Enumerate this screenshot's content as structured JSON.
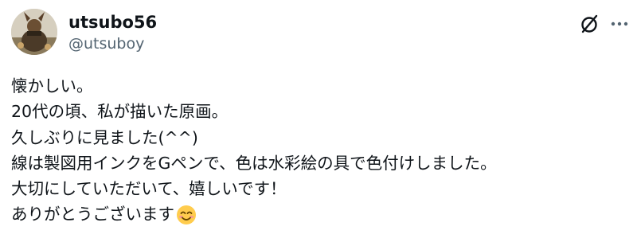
{
  "author": {
    "display_name": "utsubo56",
    "handle": "@utsuboy"
  },
  "icons": {
    "grok": "slash-circle-icon",
    "more": "more-icon",
    "emoji": "smiling-face-with-smiling-eyes-emoji"
  },
  "post": {
    "lines": [
      "懐かしい。",
      "20代の頃、私が描いた原画。",
      "久しぶりに見ました(^^)",
      "線は製図用インクをGペンで、色は水彩絵の具で色付けしました。",
      "大切にしていただいて、嬉しいです！",
      "ありがとうございます"
    ]
  },
  "colors": {
    "text": "#0f1419",
    "secondary": "#536471"
  }
}
